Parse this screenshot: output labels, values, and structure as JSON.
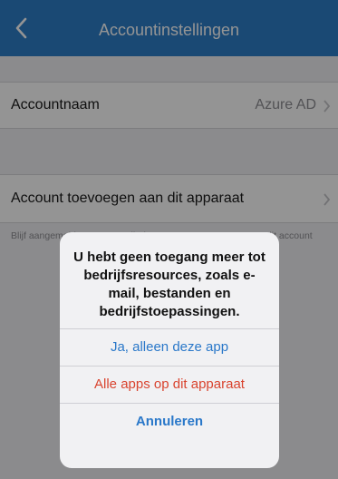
{
  "navbar": {
    "title": "Accountinstellingen",
    "back_icon": "chevron-left-icon",
    "background": "#2d7ec9"
  },
  "settings": {
    "account_name": {
      "label": "Accountnaam",
      "value": "Azure AD"
    },
    "add_account": {
      "label": "Account toevoegen aan dit apparaat",
      "footnote": "Blijf aangemeld voor compatibele apps op uw apparaat voor dit account"
    }
  },
  "alert": {
    "message": "U hebt geen toegang meer tot bedrijfsresources, zoals e-mail, bestanden en bedrijfstoepassingen.",
    "buttons": {
      "this_app": "Ja, alleen deze app",
      "all_apps": "Alle apps op dit apparaat",
      "cancel": "Annuleren"
    }
  },
  "colors": {
    "accent": "#2a78c9",
    "destructive": "#d9442f"
  }
}
